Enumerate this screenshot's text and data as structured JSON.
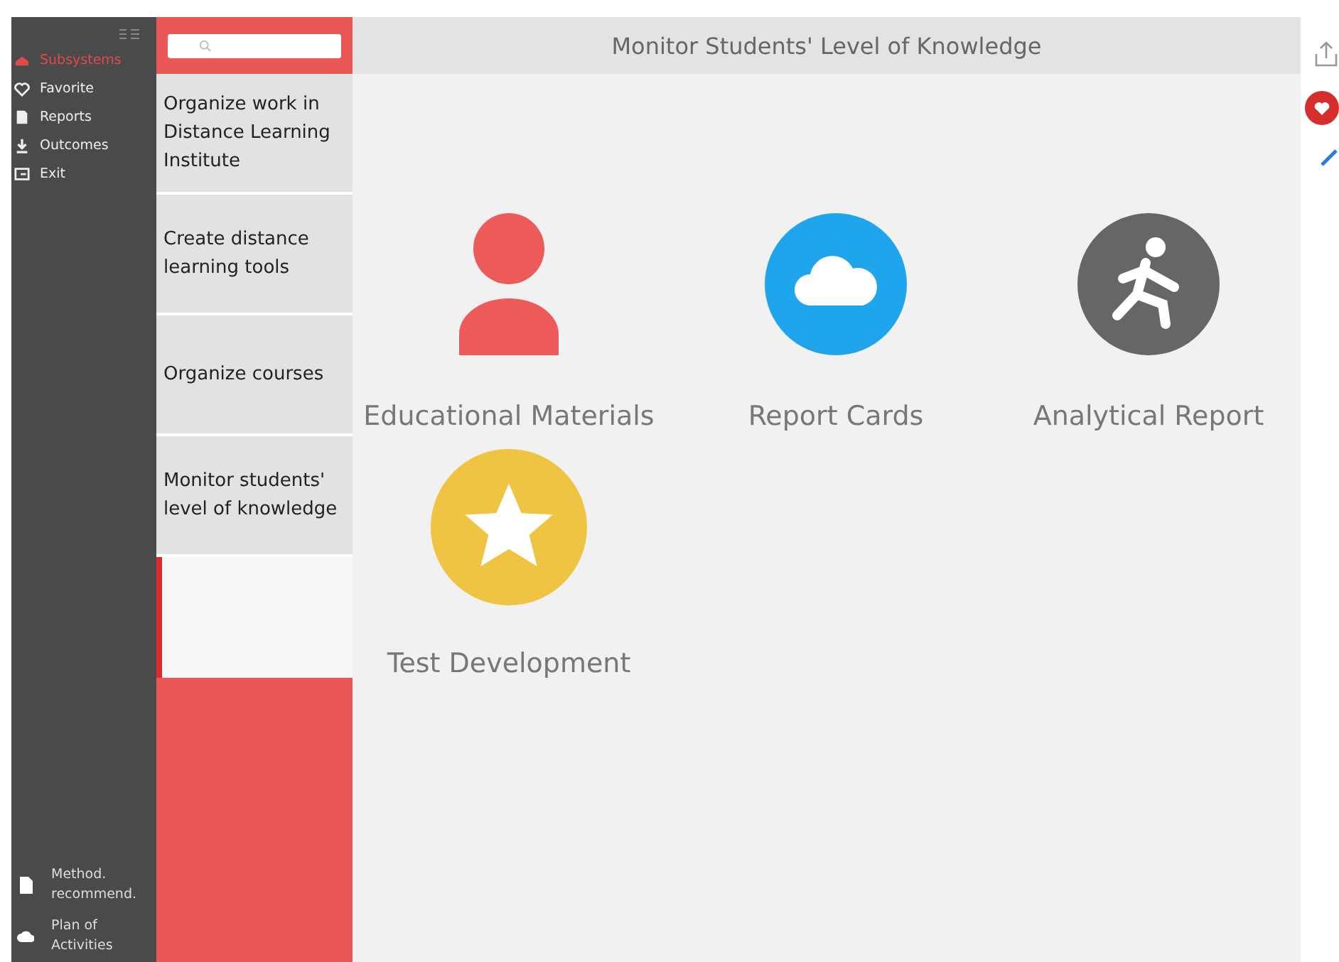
{
  "sidebar": {
    "items": [
      {
        "label": "Subsystems",
        "kind": "stack",
        "selected": true
      },
      {
        "label": "Favorite",
        "kind": "heart",
        "selected": false
      },
      {
        "label": "Reports",
        "kind": "doc",
        "selected": false
      },
      {
        "label": "Outcomes",
        "kind": "download",
        "selected": false
      },
      {
        "label": "Exit",
        "kind": "exit",
        "selected": false
      }
    ],
    "bottom_items": [
      {
        "label": "Method. recommend.",
        "kind": "doc"
      },
      {
        "label": "Plan of Activities",
        "kind": "cloud"
      }
    ]
  },
  "subsystems": {
    "items": [
      {
        "label": "Organize work in Distance Learning Institute"
      },
      {
        "label": "Create distance learning tools"
      },
      {
        "label": "Organize courses"
      },
      {
        "label": "Monitor students' level of knowledge"
      }
    ]
  },
  "main": {
    "title": "Monitor Students' Level of Knowledge",
    "tiles": [
      {
        "label": "Educational Materials",
        "kind": "person",
        "color": "#ec5a59"
      },
      {
        "label": "Report Cards",
        "kind": "cloud",
        "color": "#1ea5eb"
      },
      {
        "label": "Analytical Report",
        "kind": "runner",
        "color": "#666666"
      },
      {
        "label": "Test Development",
        "kind": "star",
        "color": "#f0c443"
      }
    ]
  }
}
